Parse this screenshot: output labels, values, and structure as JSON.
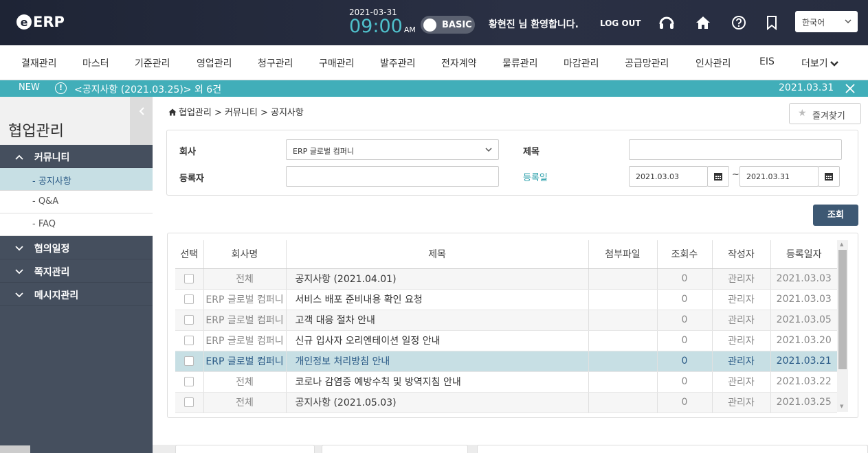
{
  "header": {
    "logo_letter": "e",
    "logo_text": "ERP",
    "date": "2021-03-31",
    "time": "09:00",
    "ampm": "AM",
    "mode_label": "BASIC",
    "welcome": "황현진 님 환영합니다.",
    "logout": "LOG OUT",
    "language": "한국어",
    "accent_color": "#4fc0cb"
  },
  "main_menu": [
    "결재관리",
    "마스터",
    "기준관리",
    "영업관리",
    "청구관리",
    "구매관리",
    "발주관리",
    "전자계약",
    "물류관리",
    "마감관리",
    "공급망관리",
    "인사관리",
    "EIS",
    "더보기"
  ],
  "notice": {
    "badge": "NEW",
    "icon_glyph": "!",
    "text": "<공지사항 (2021.03.25)> 외 6건",
    "date": "2021.03.31",
    "bar_color": "#41aeb9"
  },
  "sidebar": {
    "title": "협업관리",
    "groups": [
      {
        "label": "커뮤니티",
        "expanded": true,
        "items": [
          "- 공지사항",
          "- Q&A",
          "- FAQ"
        ]
      },
      {
        "label": "협의일정",
        "expanded": false
      },
      {
        "label": "쪽지관리",
        "expanded": false
      },
      {
        "label": "메시지관리",
        "expanded": false
      }
    ]
  },
  "breadcrumb": "협업관리 > 커뮤니티 > 공지사항",
  "favorite_label": "즐겨찾기",
  "search": {
    "company_label": "회사",
    "company_value": "ERP 글로벌 컴퍼니",
    "title_label": "제목",
    "title_value": "",
    "author_label": "등록자",
    "author_value": "",
    "date_label": "등록일",
    "date_from": "2021.03.03",
    "date_to": "2021.03.31",
    "tilde": "~",
    "button": "조회"
  },
  "grid": {
    "columns": [
      "선택",
      "회사명",
      "제목",
      "첨부파일",
      "조회수",
      "작성자",
      "등록일자"
    ],
    "rows": [
      {
        "company": "전체",
        "title": "공지사항 (2021.04.01)",
        "attach": "",
        "views": "0",
        "author": "관리자",
        "date": "2021.03.03"
      },
      {
        "company": "ERP 글로벌 컴퍼니",
        "title": "서비스 배포 준비내용 확인 요청",
        "attach": "",
        "views": "0",
        "author": "관리자",
        "date": "2021.03.03"
      },
      {
        "company": "ERP 글로벌 컴퍼니",
        "title": "고객 대응 절차 안내",
        "attach": "",
        "views": "0",
        "author": "관리자",
        "date": "2021.03.05"
      },
      {
        "company": "ERP 글로벌 컴퍼니",
        "title": "신규 입사자 오리엔테이션 일정 안내",
        "attach": "",
        "views": "0",
        "author": "관리자",
        "date": "2021.03.20"
      },
      {
        "company": "ERP 글로벌 컴퍼니",
        "title": "개인정보 처리방침 안내",
        "attach": "",
        "views": "0",
        "author": "관리자",
        "date": "2021.03.21",
        "selected": true
      },
      {
        "company": "전체",
        "title": "코로나 감염증 예방수칙 및 방역지침 안내",
        "attach": "",
        "views": "0",
        "author": "관리자",
        "date": "2021.03.22"
      },
      {
        "company": "전체",
        "title": "공지사항 (2021.05.03)",
        "attach": "",
        "views": "0",
        "author": "관리자",
        "date": "2021.03.25"
      }
    ]
  }
}
